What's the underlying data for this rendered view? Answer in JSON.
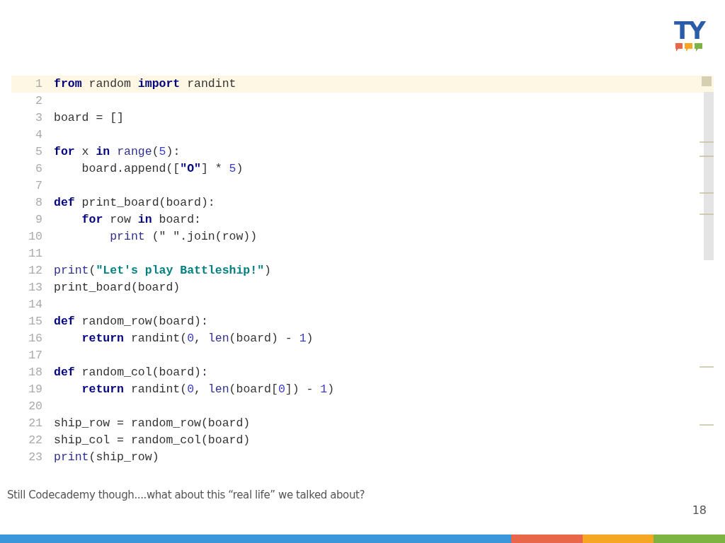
{
  "logo": {
    "text": "TY"
  },
  "editor": {
    "lines": [
      {
        "number": "1",
        "highlighted": true,
        "tokens": [
          {
            "kind": "keyword",
            "text": "from"
          },
          {
            "kind": "name",
            "text": " random "
          },
          {
            "kind": "keyword",
            "text": "import"
          },
          {
            "kind": "name",
            "text": " randint"
          }
        ]
      },
      {
        "number": "2",
        "highlighted": false
      },
      {
        "number": "3",
        "highlighted": false,
        "tokens": [
          {
            "kind": "name",
            "text": "board = []"
          }
        ]
      },
      {
        "number": "4",
        "highlighted": false
      },
      {
        "number": "5",
        "highlighted": false,
        "tokens": [
          {
            "kind": "keyword",
            "text": "for"
          },
          {
            "kind": "name",
            "text": " x "
          },
          {
            "kind": "keyword",
            "text": "in"
          },
          {
            "kind": "builtin",
            "text": " range"
          },
          {
            "kind": "name",
            "text": "("
          },
          {
            "kind": "number",
            "text": "5"
          },
          {
            "kind": "name",
            "text": "):"
          }
        ]
      },
      {
        "number": "6",
        "highlighted": false,
        "tokens": [
          {
            "kind": "name",
            "text": "    board.append(["
          },
          {
            "kind": "string",
            "text": "\"O\""
          },
          {
            "kind": "name",
            "text": "] * "
          },
          {
            "kind": "number",
            "text": "5"
          },
          {
            "kind": "name",
            "text": ")"
          }
        ]
      },
      {
        "number": "7",
        "highlighted": false
      },
      {
        "number": "8",
        "highlighted": false,
        "tokens": [
          {
            "kind": "keyword",
            "text": "def"
          },
          {
            "kind": "name",
            "text": " print_board(board):"
          }
        ]
      },
      {
        "number": "9",
        "highlighted": false,
        "tokens": [
          {
            "kind": "keyword",
            "text": "    for"
          },
          {
            "kind": "name",
            "text": " row "
          },
          {
            "kind": "keyword",
            "text": "in"
          },
          {
            "kind": "name",
            "text": " board:"
          }
        ]
      },
      {
        "number": "10",
        "highlighted": false,
        "tokens": [
          {
            "kind": "builtin",
            "text": "        print"
          },
          {
            "kind": "name",
            "text": " (\" \".join(row))"
          }
        ]
      },
      {
        "number": "11",
        "highlighted": false
      },
      {
        "number": "12",
        "highlighted": false,
        "tokens": [
          {
            "kind": "builtin",
            "text": "print"
          },
          {
            "kind": "name",
            "text": "("
          },
          {
            "kind": "message",
            "text": "\"Let's play Battleship!\""
          },
          {
            "kind": "name",
            "text": ")"
          }
        ]
      },
      {
        "number": "13",
        "highlighted": false,
        "tokens": [
          {
            "kind": "name",
            "text": "print_board(board)"
          }
        ]
      },
      {
        "number": "14",
        "highlighted": false
      },
      {
        "number": "15",
        "highlighted": false,
        "tokens": [
          {
            "kind": "keyword",
            "text": "def"
          },
          {
            "kind": "name",
            "text": " random_row(board):"
          }
        ]
      },
      {
        "number": "16",
        "highlighted": false,
        "tokens": [
          {
            "kind": "keyword",
            "text": "    return"
          },
          {
            "kind": "name",
            "text": " randint("
          },
          {
            "kind": "number",
            "text": "0"
          },
          {
            "kind": "name",
            "text": ", "
          },
          {
            "kind": "builtin",
            "text": "len"
          },
          {
            "kind": "name",
            "text": "(board) - "
          },
          {
            "kind": "number",
            "text": "1"
          },
          {
            "kind": "name",
            "text": ")"
          }
        ]
      },
      {
        "number": "17",
        "highlighted": false
      },
      {
        "number": "18",
        "highlighted": false,
        "tokens": [
          {
            "kind": "keyword",
            "text": "def"
          },
          {
            "kind": "name",
            "text": " random_col(board):"
          }
        ]
      },
      {
        "number": "19",
        "highlighted": false,
        "tokens": [
          {
            "kind": "keyword",
            "text": "    return"
          },
          {
            "kind": "name",
            "text": " randint("
          },
          {
            "kind": "number",
            "text": "0"
          },
          {
            "kind": "name",
            "text": ", "
          },
          {
            "kind": "builtin",
            "text": "len"
          },
          {
            "kind": "name",
            "text": "(board["
          },
          {
            "kind": "number",
            "text": "0"
          },
          {
            "kind": "name",
            "text": "]) - "
          },
          {
            "kind": "number",
            "text": "1"
          },
          {
            "kind": "name",
            "text": ")"
          }
        ]
      },
      {
        "number": "20",
        "highlighted": false
      },
      {
        "number": "21",
        "highlighted": false,
        "tokens": [
          {
            "kind": "name",
            "text": "ship_row = random_row(board)"
          }
        ]
      },
      {
        "number": "22",
        "highlighted": false,
        "tokens": [
          {
            "kind": "name",
            "text": "ship_col = random_col(board)"
          }
        ]
      },
      {
        "number": "23",
        "highlighted": false,
        "tokens": [
          {
            "kind": "builtin",
            "text": "print"
          },
          {
            "kind": "name",
            "text": "(ship_row)"
          }
        ]
      }
    ]
  },
  "caption": "Still Codecademy though....what about this “real life” we talked about?",
  "page_number": "18"
}
